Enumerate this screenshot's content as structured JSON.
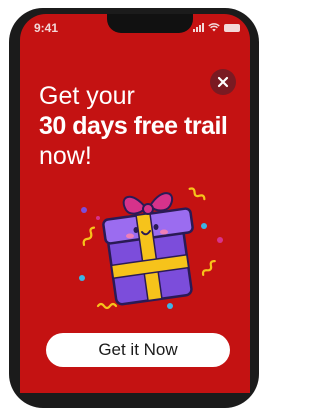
{
  "status_bar": {
    "time": "9:41"
  },
  "promo": {
    "line1": "Get your",
    "line2": "30 days free trail",
    "line3": "now!",
    "cta_label": "Get it Now"
  },
  "icons": {
    "close": "close-icon",
    "gift": "gift-box-illustration"
  },
  "colors": {
    "background": "#c41212",
    "close_button": "#7a1a22",
    "gift_box": "#7c4ddb",
    "ribbon": "#f6c31b",
    "bow": "#d6328b",
    "cta_background": "#ffffff"
  }
}
